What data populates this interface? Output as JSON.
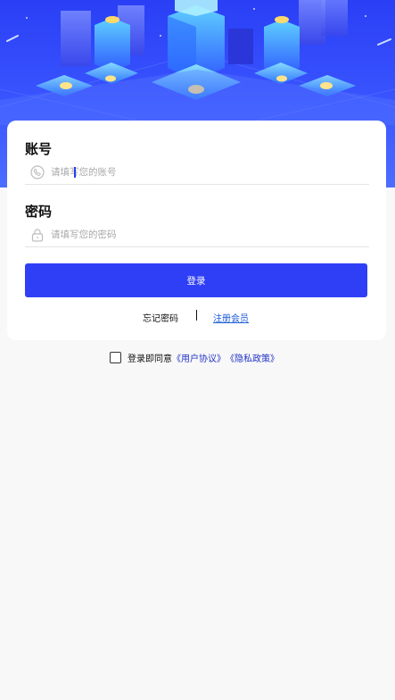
{
  "login_form": {
    "account_label": "账号",
    "account_placeholder": "请填写您的账号",
    "password_label": "密码",
    "password_placeholder": "请填写您的密码",
    "submit_label": "登录",
    "forgot_password_label": "忘记密码",
    "register_label": "注册会员"
  },
  "agreement": {
    "prefix": "登录即同意",
    "user_agreement": "《用户协议》",
    "privacy_policy": "《隐私政策》",
    "checked": false
  },
  "icons": {
    "account": "phone-icon",
    "password": "lock-icon"
  },
  "colors": {
    "primary": "#2e3ff6",
    "link": "#1c5bd6",
    "hero": "#2a3ff5"
  }
}
